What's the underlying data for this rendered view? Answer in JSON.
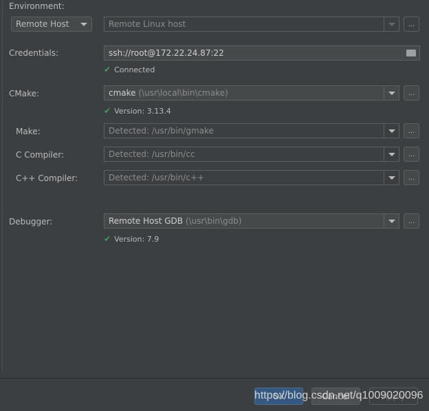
{
  "environment": {
    "label": "Environment:",
    "type_value": "Remote Host",
    "host_value": "Remote Linux host",
    "more": "..."
  },
  "credentials": {
    "label": "Credentials:",
    "value": "ssh://root@172.22.24.87:22",
    "status": "Connected"
  },
  "cmake": {
    "label": "CMake:",
    "value": "cmake",
    "path": "(\\usr\\local\\bin\\cmake)",
    "status": "Version: 3.13.4",
    "more": "..."
  },
  "make": {
    "label": "Make:",
    "value": "Detected: /usr/bin/gmake",
    "more": "..."
  },
  "c_compiler": {
    "label": "C Compiler:",
    "value": "Detected: /usr/bin/cc",
    "more": "..."
  },
  "cpp_compiler": {
    "label": "C++ Compiler:",
    "value": "Detected: /usr/bin/c++",
    "more": "..."
  },
  "debugger": {
    "label": "Debugger:",
    "value": "Remote Host GDB",
    "path": "(\\usr\\bin\\gdb)",
    "status": "Version: 7.9",
    "more": "..."
  },
  "buttons": {
    "ok": "OK",
    "cancel": "Cancel",
    "apply": "Apply"
  },
  "watermark": "https://blog.csdn.net/q1009020096",
  "colors": {
    "background": "#3c3f41",
    "accent": "#365880",
    "success": "#499c54"
  }
}
